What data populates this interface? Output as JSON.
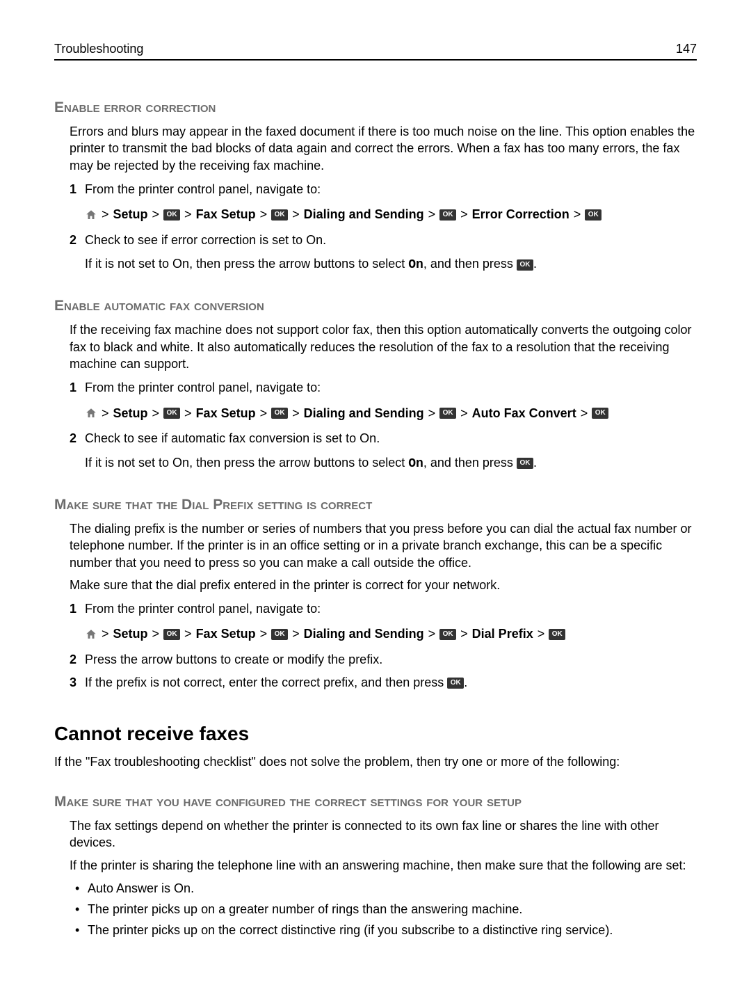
{
  "header": {
    "left": "Troubleshooting",
    "right": "147"
  },
  "labels": {
    "ok": "OK",
    "gt": ">"
  },
  "path_common": {
    "setup": "Setup",
    "fax_setup": "Fax Setup",
    "dialing_sending": "Dialing and Sending"
  },
  "sec1": {
    "title": "Enable error correction",
    "intro": "Errors and blurs may appear in the faxed document if there is too much noise on the line. This option enables the printer to transmit the bad blocks of data again and correct the errors. When a fax has too many errors, the fax may be rejected by the receiving fax machine.",
    "step1": "From the printer control panel, navigate to:",
    "target": "Error Correction",
    "step2": "Check to see if error correction is set to On.",
    "sub_a": "If it is not set to On, then press the arrow buttons to select ",
    "sub_on": "On",
    "sub_b": ", and then press "
  },
  "sec2": {
    "title": "Enable automatic fax conversion",
    "intro": "If the receiving fax machine does not support color fax, then this option automatically converts the outgoing color fax to black and white. It also automatically reduces the resolution of the fax to a resolution that the receiving machine can support.",
    "step1": "From the printer control panel, navigate to:",
    "target": "Auto Fax Convert",
    "step2": "Check to see if automatic fax conversion is set to On.",
    "sub_a": "If it is not set to On, then press the arrow buttons to select ",
    "sub_on": "On",
    "sub_b": ", and then press "
  },
  "sec3": {
    "title": "Make sure that the Dial Prefix setting is correct",
    "intro": "The dialing prefix is the number or series of numbers that you press before you can dial the actual fax number or telephone number. If the printer is in an office setting or in a private branch exchange, this can be a specific number that you need to press so you can make a call outside the office.",
    "extra": "Make sure that the dial prefix entered in the printer is correct for your network.",
    "step1": "From the printer control panel, navigate to:",
    "target": "Dial Prefix",
    "step2": "Press the arrow buttons to create or modify the prefix.",
    "step3": "If the prefix is not correct, enter the correct prefix, and then press "
  },
  "h2": {
    "title": "Cannot receive faxes",
    "intro": "If the \"Fax troubleshooting checklist\" does not solve the problem, then try one or more of the following:"
  },
  "sec4": {
    "title": "Make sure that you have configured the correct settings for your setup",
    "p1": "The fax settings depend on whether the printer is connected to its own fax line or shares the line with other devices.",
    "p2": "If the printer is sharing the telephone line with an answering machine, then make sure that the following are set:",
    "bullets": [
      "Auto Answer is On.",
      "The printer picks up on a greater number of rings than the answering machine.",
      "The printer picks up on the correct distinctive ring (if you subscribe to a distinctive ring service)."
    ]
  }
}
